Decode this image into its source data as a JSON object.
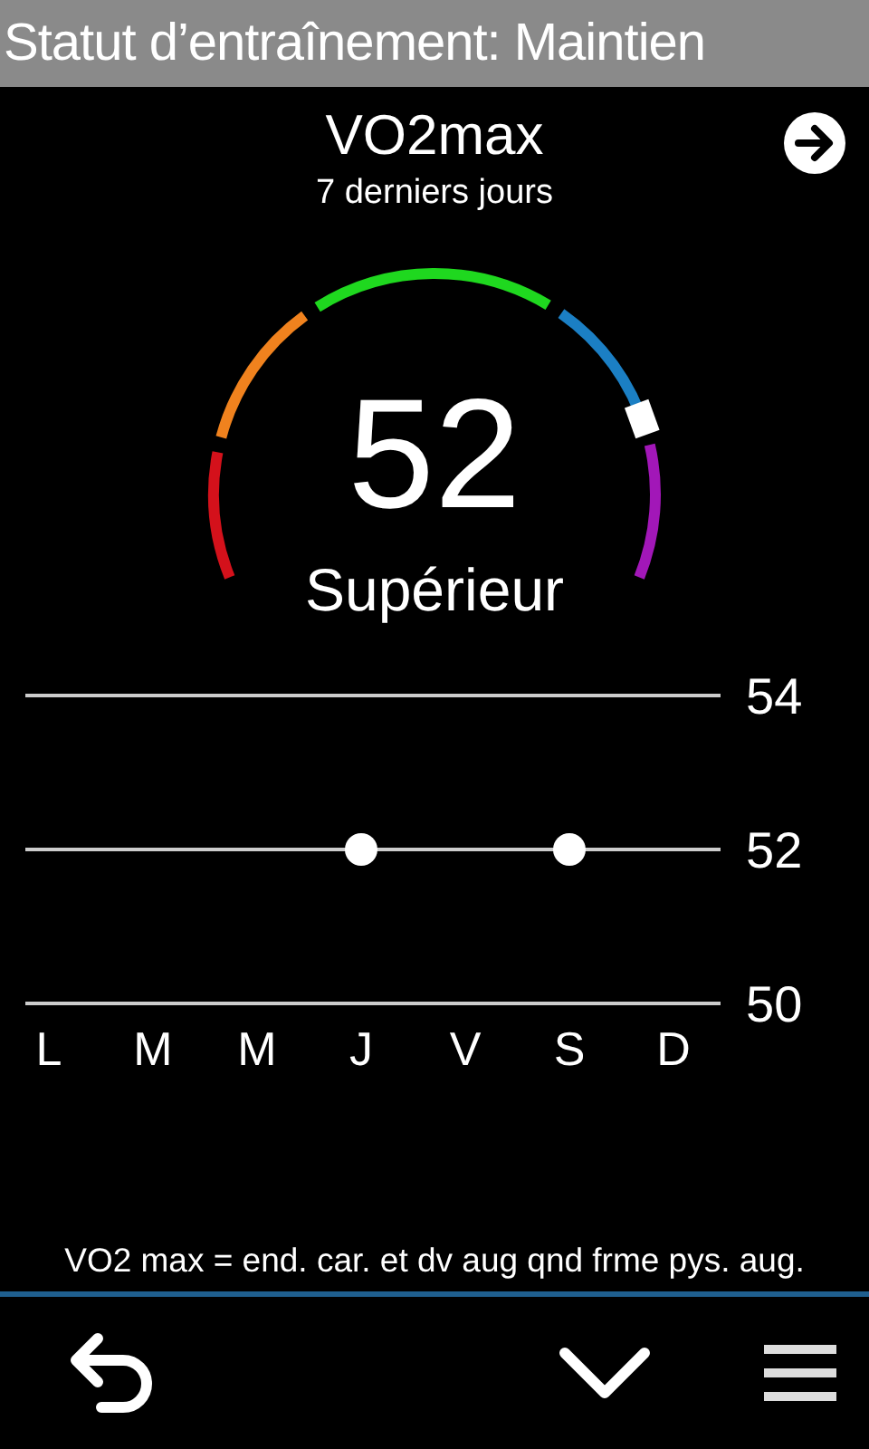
{
  "header": {
    "title": "Statut d’entraînement: Maintien"
  },
  "metric": {
    "title": "VO2max",
    "subtitle": "7 derniers jours",
    "value": "52",
    "rating": "Supérieur"
  },
  "history": {
    "chart_data": {
      "type": "scatter",
      "categories": [
        "L",
        "M",
        "M",
        "J",
        "V",
        "S",
        "D"
      ],
      "series": [
        {
          "color": "#ffffff",
          "values": [
            null,
            null,
            null,
            52,
            null,
            52,
            null
          ]
        }
      ],
      "ylim": [
        50,
        54
      ],
      "yticks": [
        50,
        52,
        54
      ]
    }
  },
  "footnote": "VO2 max = end. car. et dv aug qnd frme pys. aug."
}
